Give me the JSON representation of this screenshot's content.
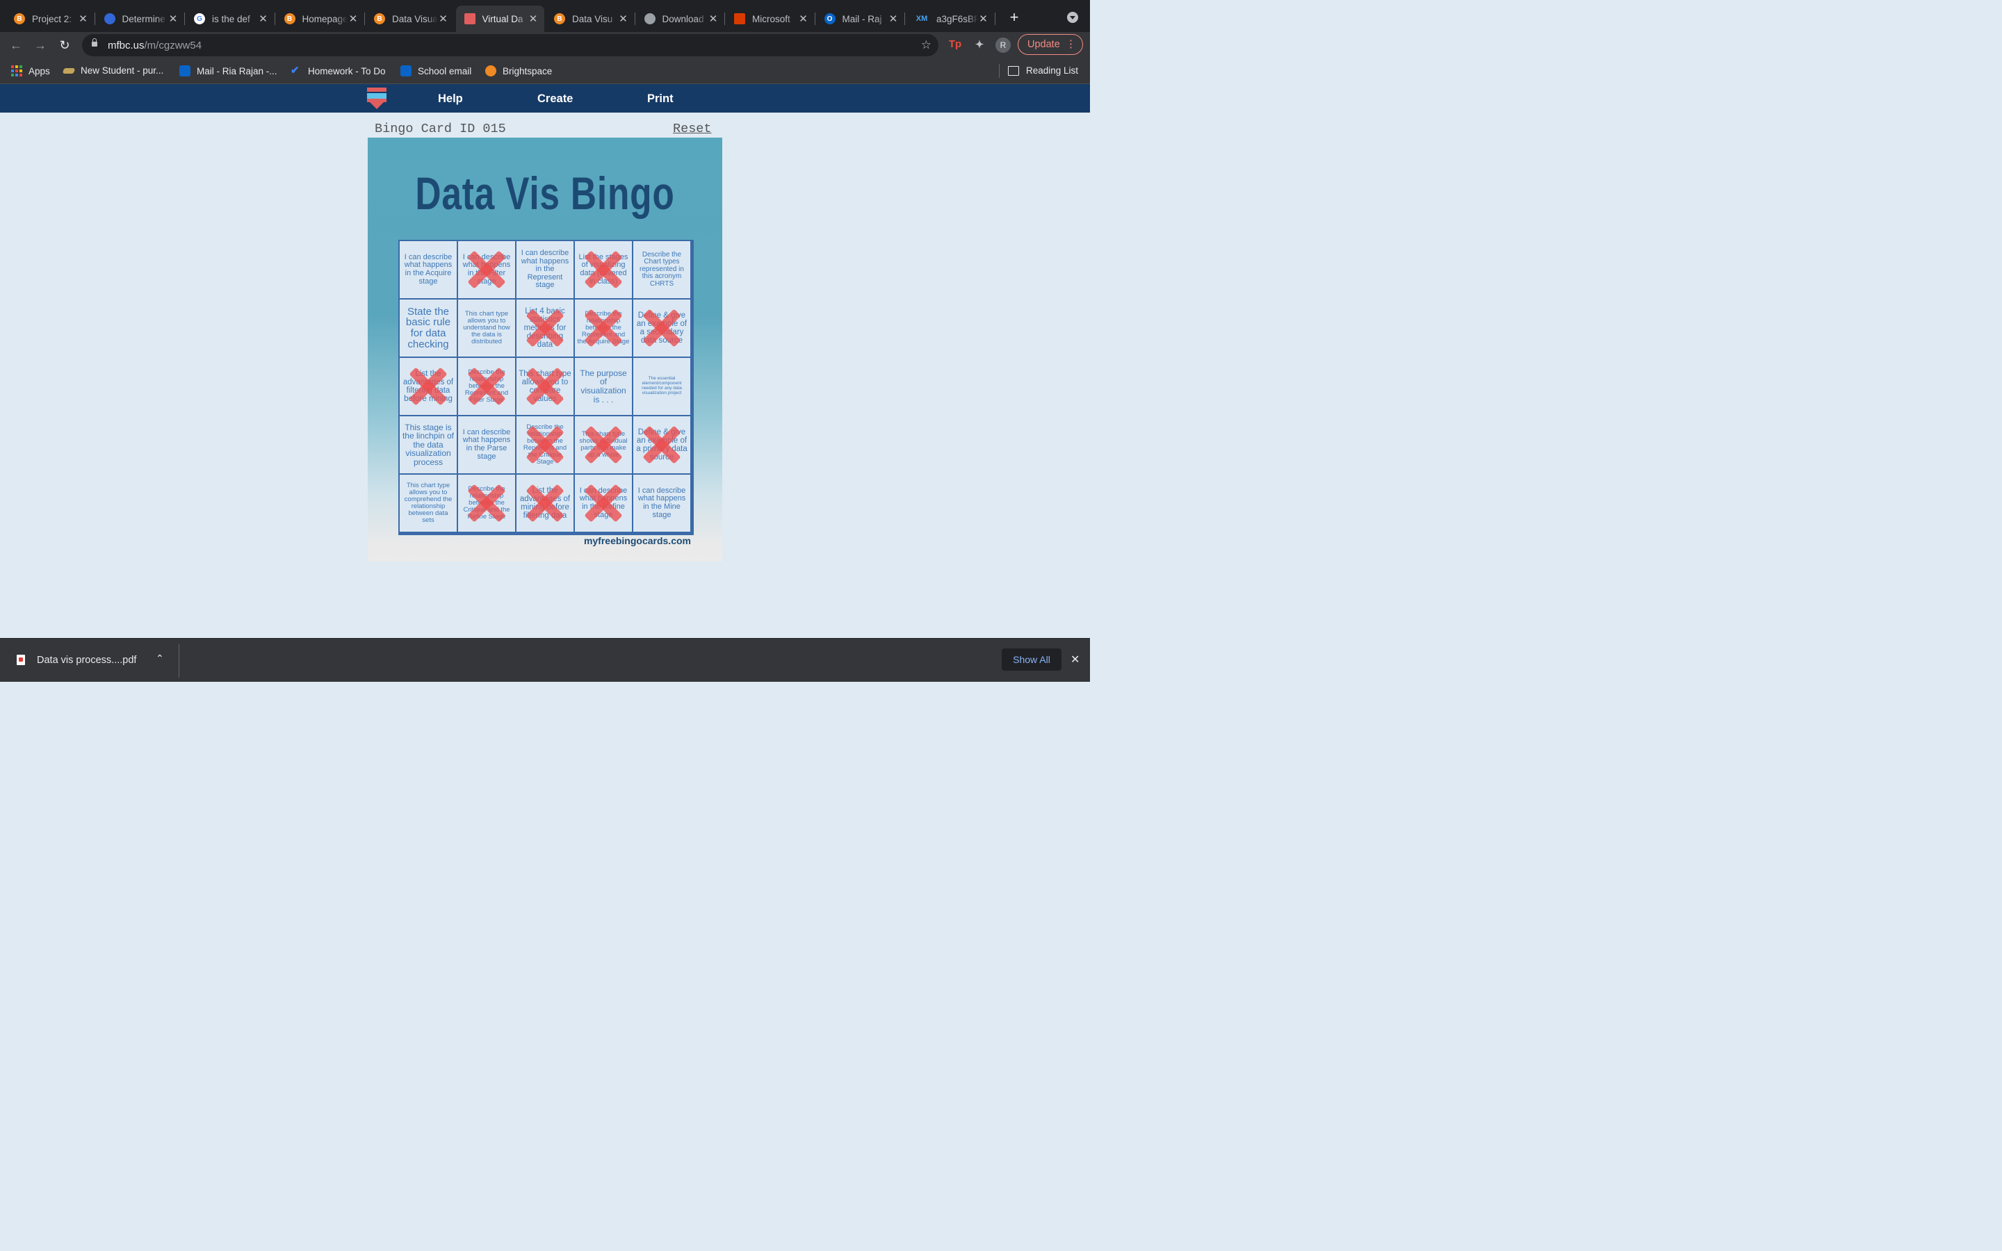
{
  "browser": {
    "tabs": [
      {
        "title": "Project 2:",
        "favicon": "brightspace-icon",
        "color": "#f08a24",
        "letter": "B"
      },
      {
        "title": "Determine",
        "favicon": "circle-logo-icon",
        "color": "#3367d6",
        "letter": ""
      },
      {
        "title": "is the def",
        "favicon": "google-icon",
        "color": "#ffffff",
        "letter": "G"
      },
      {
        "title": "Homepage",
        "favicon": "brightspace-icon",
        "color": "#f08a24",
        "letter": "B"
      },
      {
        "title": "Data Visua",
        "favicon": "brightspace-icon",
        "color": "#f08a24",
        "letter": "B"
      },
      {
        "title": "Virtual Da",
        "favicon": "bingo-logo-icon",
        "color": "#e25d5d",
        "letter": ""
      },
      {
        "title": "Data Visu",
        "favicon": "brightspace-icon",
        "color": "#f08a24",
        "letter": "B"
      },
      {
        "title": "Download",
        "favicon": "globe-icon",
        "color": "#9aa0a6",
        "letter": ""
      },
      {
        "title": "Microsoft",
        "favicon": "office-icon",
        "color": "#d83b01",
        "letter": ""
      },
      {
        "title": "Mail - Raj",
        "favicon": "outlook-icon",
        "color": "#0a64c8",
        "letter": "O"
      },
      {
        "title": "a3gF6sBF",
        "favicon": "xm-icon",
        "color": "#4aa3f0",
        "letter": "XM"
      }
    ],
    "active_tab": 5,
    "url_host": "mfbc.us",
    "url_path": "/m/cgzww54",
    "update_label": "Update",
    "avatar_letter": "R",
    "bookmarks": [
      {
        "label": "Apps",
        "icon": "apps-grid-icon"
      },
      {
        "label": "New Student - pur...",
        "icon": "purdue-icon",
        "color": "#c4a35a"
      },
      {
        "label": "Mail - Ria Rajan -...",
        "icon": "outlook-icon",
        "color": "#0a64c8"
      },
      {
        "label": "Homework - To Do",
        "icon": "todo-check-icon",
        "color": "#3b82f6"
      },
      {
        "label": "School email",
        "icon": "outlook-icon",
        "color": "#0a64c8"
      },
      {
        "label": "Brightspace",
        "icon": "brightspace-icon",
        "color": "#f08a24"
      }
    ],
    "reading_list": "Reading List"
  },
  "site": {
    "nav": [
      "Help",
      "Create",
      "Print"
    ],
    "card_id_label": "Bingo Card ID 015",
    "reset_label": "Reset",
    "card_title": "Data Vis Bingo",
    "brand": "myfreebingocards.com"
  },
  "bingo": {
    "cells": [
      {
        "text": "I can describe what happens in the Acquire stage",
        "marked": false,
        "size": 11
      },
      {
        "text": "I can describe what happens in the Filter stage",
        "marked": true,
        "size": 11
      },
      {
        "text": "I can describe what happens in the Represent stage",
        "marked": false,
        "size": 11
      },
      {
        "text": "List the stages of visualizing data (covered in class)",
        "marked": true,
        "size": 11
      },
      {
        "text": "Describe the Chart types represented in this acronym CHRTS",
        "marked": false,
        "size": 10
      },
      {
        "text": "State the basic rule for data checking",
        "marked": false,
        "size": 15
      },
      {
        "text": "This chart type allows you to understand how the data is distributed",
        "marked": false,
        "size": 9.5
      },
      {
        "text": "List 4 basic statistics methods for describing data",
        "marked": true,
        "size": 11.5
      },
      {
        "text": "Describe the relationship between the Represent and the Acquire Stage",
        "marked": true,
        "size": 9.5
      },
      {
        "text": "Define & give an example of a secondary data source",
        "marked": true,
        "size": 11.5
      },
      {
        "text": "List the advantages of filtering data before mining",
        "marked": true,
        "size": 11.5
      },
      {
        "text": "Describe the relationship between the Represent and Filter Stage",
        "marked": true,
        "size": 9.5
      },
      {
        "text": "This chart type allows you to compare values",
        "marked": true,
        "size": 11.5
      },
      {
        "text": "The purpose of visualization is . . .",
        "marked": false,
        "size": 12
      },
      {
        "text": "The essential element/component needed for any data visualization project",
        "marked": false,
        "size": 6.5
      },
      {
        "text": "This stage is the linchpin of the data visualization process",
        "marked": false,
        "size": 12
      },
      {
        "text": "I can describe what happens in the Parse stage",
        "marked": false,
        "size": 11
      },
      {
        "text": "Describe the relationship between the Represent and the Critique Stage",
        "marked": true,
        "size": 9.5
      },
      {
        "text": "This chart type shows individual parts that make up a whole",
        "marked": true,
        "size": 9.5
      },
      {
        "text": "Define & give an example of a primary data source",
        "marked": true,
        "size": 11.5
      },
      {
        "text": "This chart type allows you to comprehend the relationship between data sets",
        "marked": false,
        "size": 9.5
      },
      {
        "text": "Describe the relationship between the Critique and the Refine Stage",
        "marked": true,
        "size": 9.5
      },
      {
        "text": "List the advantages of mining before filtering data",
        "marked": true,
        "size": 11.5
      },
      {
        "text": "I can describe what happens in the Refine stage",
        "marked": true,
        "size": 11
      },
      {
        "text": "I can describe what happens in the Mine stage",
        "marked": false,
        "size": 11
      }
    ]
  },
  "download": {
    "file": "Data vis process....pdf",
    "show_all": "Show All"
  }
}
